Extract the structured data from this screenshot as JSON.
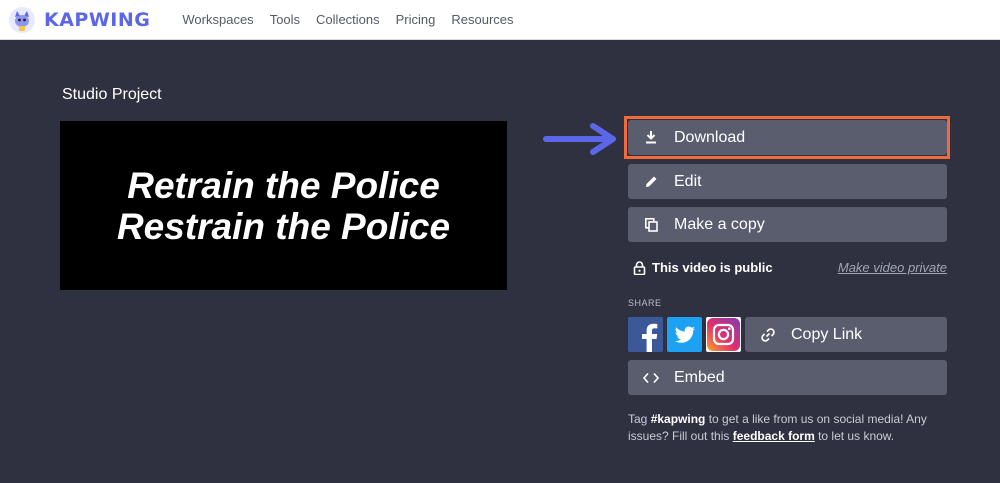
{
  "header": {
    "logo_text": "KAPWING",
    "nav": [
      "Workspaces",
      "Tools",
      "Collections",
      "Pricing",
      "Resources"
    ]
  },
  "project": {
    "title": "Studio Project",
    "preview_lines": [
      "Retrain the Police",
      "Restrain the Police"
    ]
  },
  "actions": {
    "download": "Download",
    "edit": "Edit",
    "make_copy": "Make a copy",
    "copy_link": "Copy Link",
    "embed": "Embed"
  },
  "privacy": {
    "status": "This video is public",
    "link": "Make video private"
  },
  "share": {
    "label": "SHARE",
    "icons": [
      "facebook-icon",
      "twitter-icon",
      "instagram-icon"
    ]
  },
  "footer": {
    "text_1": "Tag ",
    "hashtag": "#kapwing",
    "text_2": " to get a like from us on social media! Any issues? Fill out this ",
    "feedback_link": "feedback form",
    "text_3": " to let us know."
  },
  "colors": {
    "background": "#2f3140",
    "button": "#5a5d6d",
    "brand": "#5b67e8",
    "highlight": "#f06a3d",
    "arrow": "#5b67e8"
  }
}
